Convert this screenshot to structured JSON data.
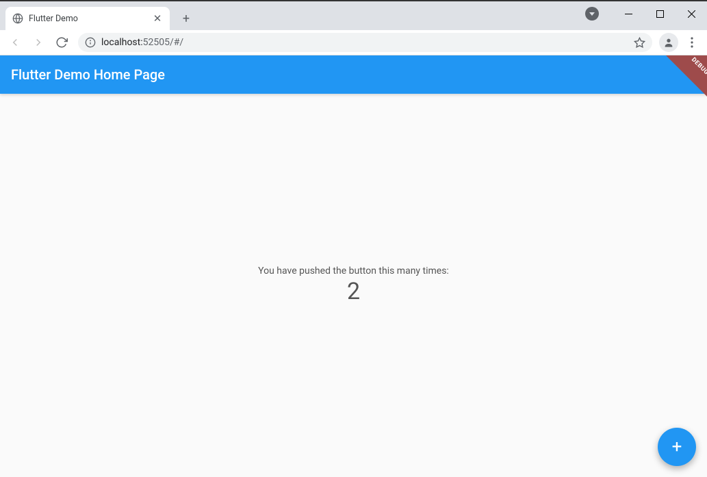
{
  "browser": {
    "tab": {
      "title": "Flutter Demo"
    },
    "url": {
      "host": "localhost:",
      "port_path": "52505/#/"
    }
  },
  "app": {
    "appbar_title": "Flutter Demo Home Page",
    "debug_label": "DEBUG",
    "body_text": "You have pushed the button this many times:",
    "counter": "2"
  }
}
